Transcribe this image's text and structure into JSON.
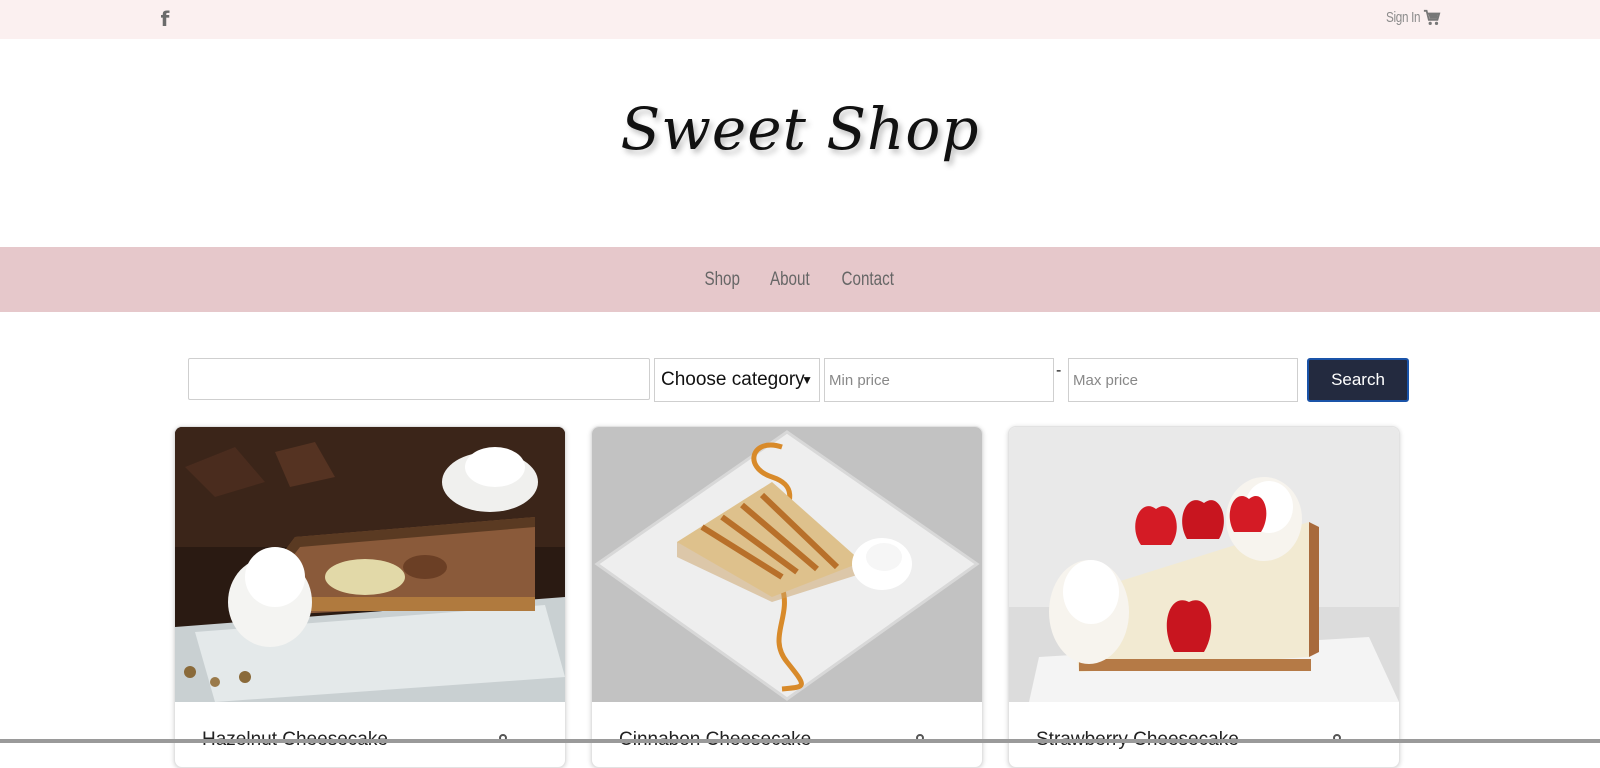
{
  "topbar": {
    "facebook_icon": "facebook-icon",
    "signin_label": "Sign In",
    "cart_icon": "shopping-cart-icon"
  },
  "brand": {
    "title": "Sweet Shop"
  },
  "nav": {
    "items": [
      {
        "label": "Shop"
      },
      {
        "label": "About"
      },
      {
        "label": "Contact"
      }
    ]
  },
  "search": {
    "query_value": "",
    "category_selected": "Choose category",
    "min_placeholder": "Min price",
    "separator": "-",
    "max_placeholder": "Max price",
    "button_label": "Search"
  },
  "products": [
    {
      "name": "Hazelnut Cheesecake",
      "image": "hazelnut-cheesecake-photo"
    },
    {
      "name": "Cinnabon Cheesecake",
      "image": "cinnabon-cheesecake-photo"
    },
    {
      "name": "Strawberry Cheesecake",
      "image": "strawberry-cheesecake-photo"
    }
  ],
  "colors": {
    "topbar_bg": "#fbf0f0",
    "nav_bg": "#e6c8cb",
    "search_button_bg": "#232a3f",
    "search_button_border": "#1a53a8"
  }
}
